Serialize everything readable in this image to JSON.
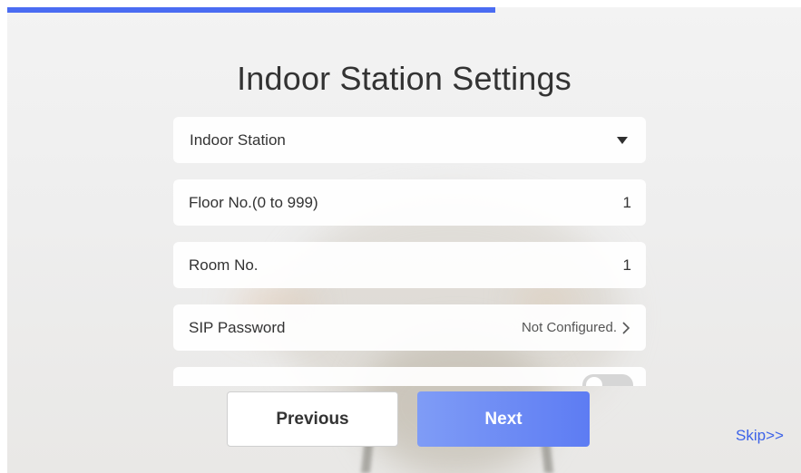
{
  "progress": {
    "percent": 61.5,
    "color": "#4a6cf2"
  },
  "page_title": "Indoor Station Settings",
  "device_type": {
    "selected": "Indoor Station",
    "icon": "caret-down-icon"
  },
  "floor": {
    "label": "Floor No.(0 to 999)",
    "value": "1"
  },
  "room": {
    "label": "Room No.",
    "value": "1"
  },
  "sip": {
    "label": "SIP Password",
    "value": "Not Configured.",
    "icon": "chevron-right-icon"
  },
  "partial_row": {
    "toggle_state": "off"
  },
  "buttons": {
    "previous": "Previous",
    "next": "Next",
    "skip": "Skip>>"
  },
  "colors": {
    "accent": "#4a6cf2",
    "next_button": "#6787f4",
    "skip_link": "#3d63e8"
  }
}
